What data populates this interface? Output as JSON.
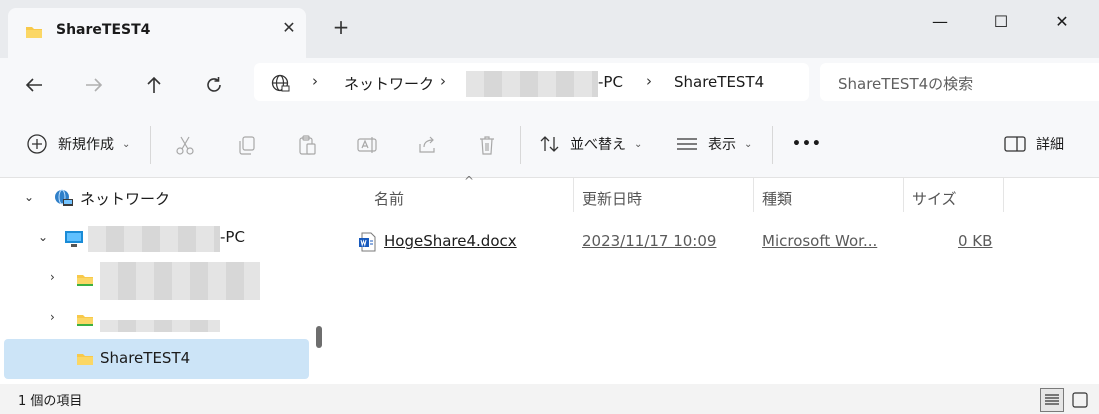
{
  "window": {
    "tab_title": "ShareTEST4",
    "tab_close": "✕",
    "new_tab": "+",
    "minimize": "—",
    "maximize": "☐",
    "close": "✕"
  },
  "address_bar": {
    "root": "ネットワーク",
    "pc_suffix": "-PC",
    "share": "ShareTEST4",
    "separator": "›",
    "search_placeholder": "ShareTEST4の検索"
  },
  "toolbar": {
    "new_label": "新規作成",
    "sort_label": "並べ替え",
    "view_label": "表示",
    "more_label": "•••",
    "details_label": "詳細"
  },
  "nav_tree": {
    "network": "ネットワーク",
    "pc_suffix": "-PC",
    "share": "ShareTEST4"
  },
  "columns": {
    "name": "名前",
    "modified": "更新日時",
    "type": "種類",
    "size": "サイズ"
  },
  "files": [
    {
      "name": "HogeShare4.docx",
      "modified": "2023/11/17 10:09",
      "type": "Microsoft Wor...",
      "size": "0 KB"
    }
  ],
  "status": {
    "item_count": "1 個の項目"
  },
  "icons": {
    "folder": "folder-icon",
    "word": "word-doc-icon",
    "network": "network-icon",
    "pc": "pc-icon"
  },
  "colors": {
    "selection": "#cce4f7",
    "folder": "#f8c94a",
    "word_blue": "#185abd",
    "accent": "#0067c0"
  }
}
